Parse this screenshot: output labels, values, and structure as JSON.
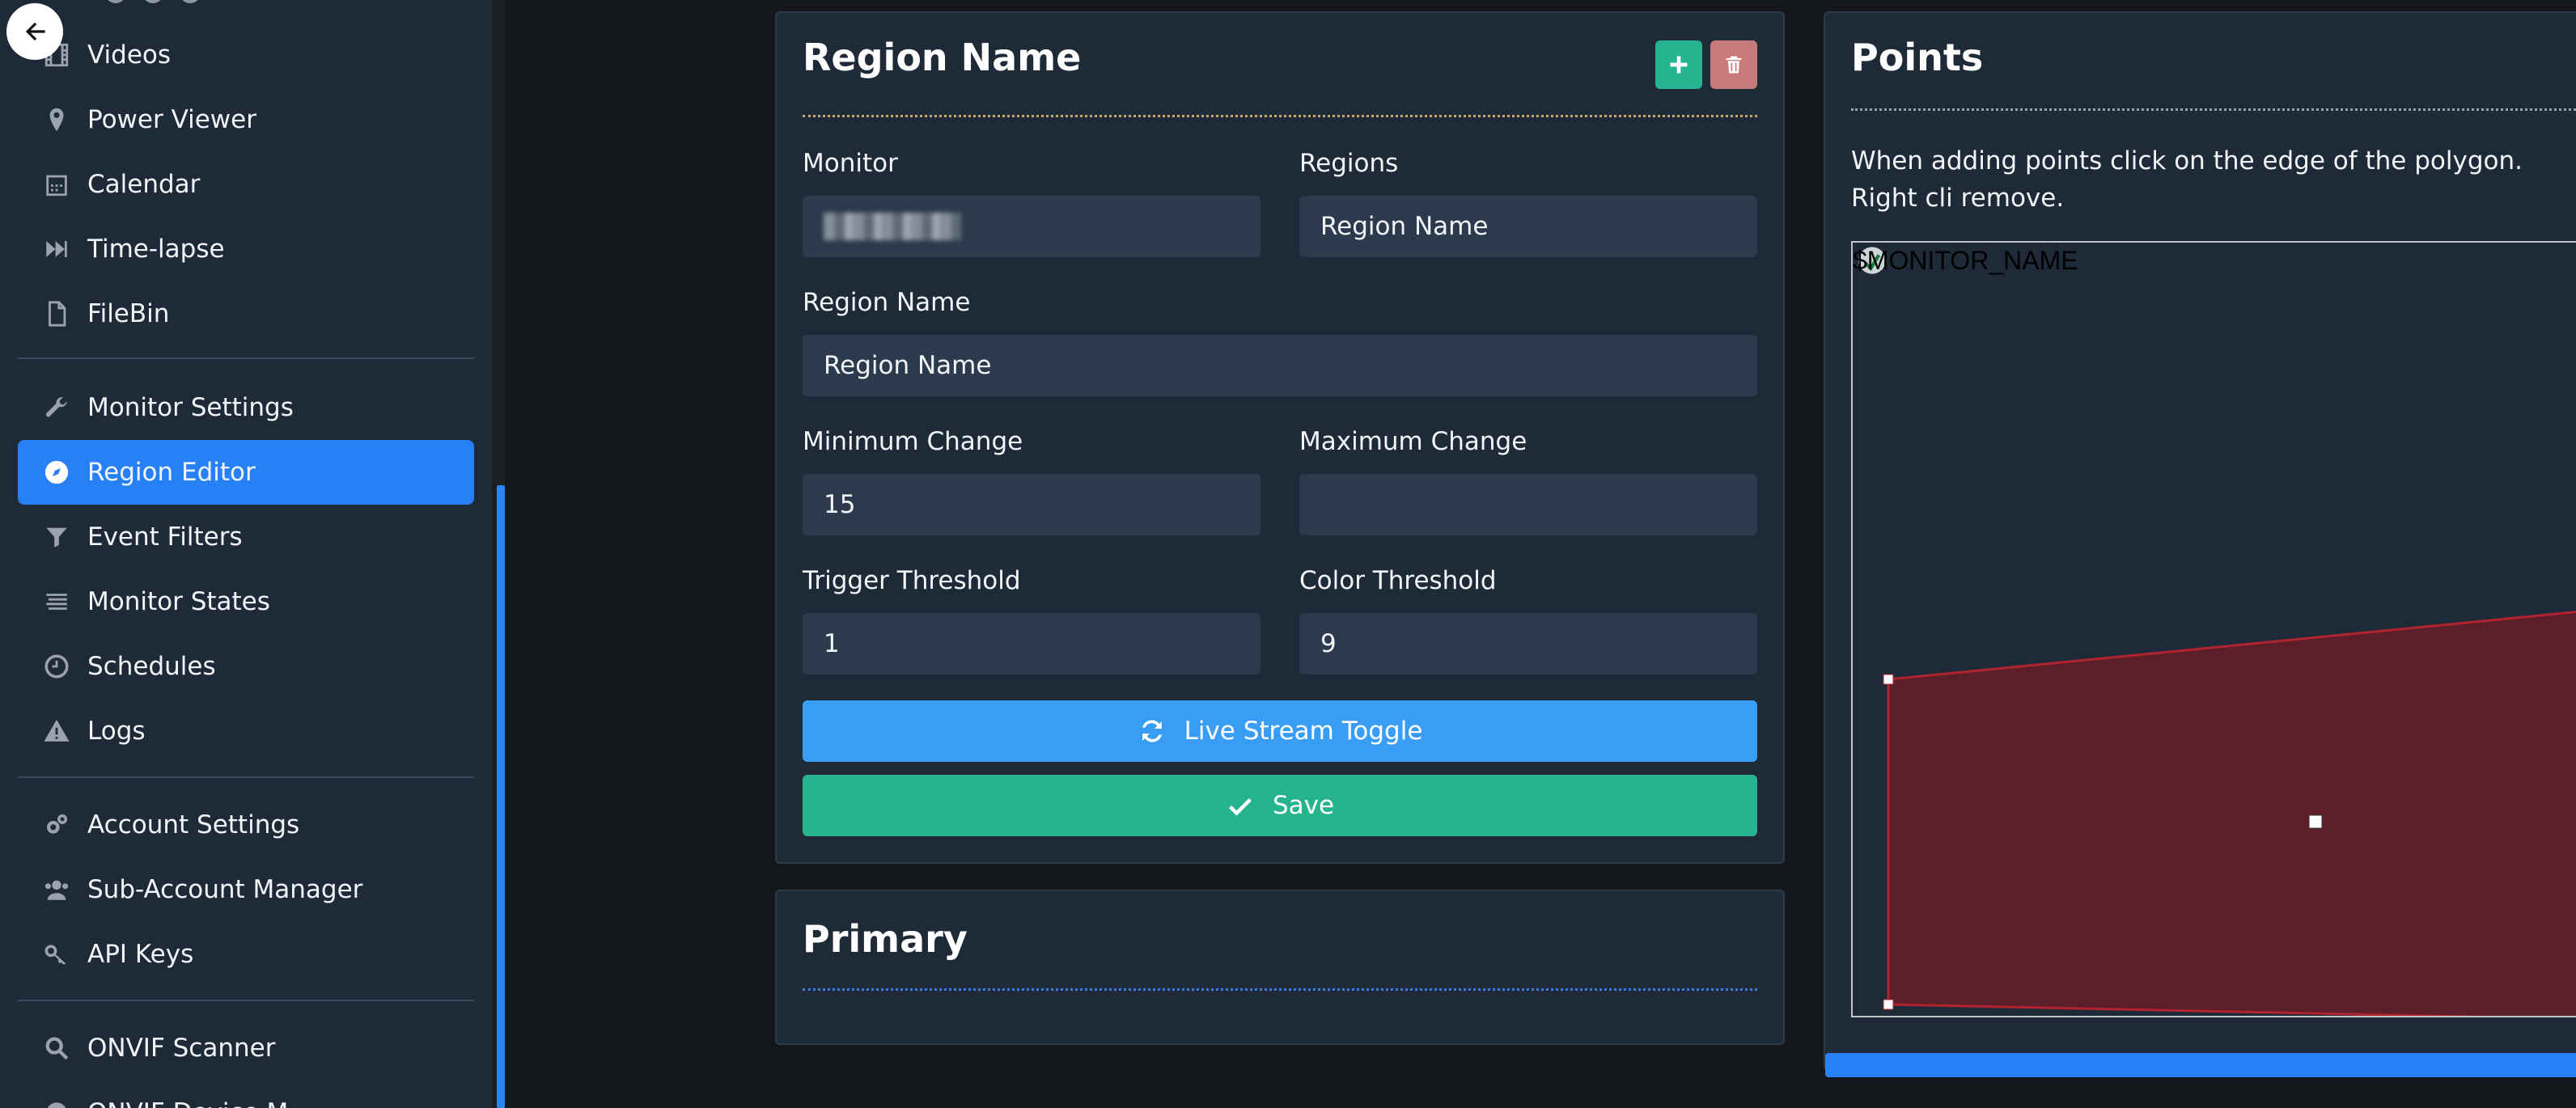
{
  "sidebar": {
    "items": [
      {
        "label": "Videos",
        "icon": "film-icon"
      },
      {
        "label": "Power Viewer",
        "icon": "map-pin-icon"
      },
      {
        "label": "Calendar",
        "icon": "calendar-icon"
      },
      {
        "label": "Time-lapse",
        "icon": "fast-forward-icon"
      },
      {
        "label": "FileBin",
        "icon": "file-icon"
      },
      {
        "label": "Monitor Settings",
        "icon": "wrench-icon"
      },
      {
        "label": "Region Editor",
        "icon": "compass-icon",
        "active": true
      },
      {
        "label": "Event Filters",
        "icon": "filter-icon"
      },
      {
        "label": "Monitor States",
        "icon": "list-icon"
      },
      {
        "label": "Schedules",
        "icon": "clock-icon"
      },
      {
        "label": "Logs",
        "icon": "warning-icon"
      },
      {
        "label": "Account Settings",
        "icon": "cogs-icon"
      },
      {
        "label": "Sub-Account Manager",
        "icon": "users-icon"
      },
      {
        "label": "API Keys",
        "icon": "key-icon"
      },
      {
        "label": "ONVIF Scanner",
        "icon": "search-icon"
      },
      {
        "label": "ONVIF Device M",
        "icon": "globe-icon"
      }
    ]
  },
  "region_card": {
    "title": "Region Name",
    "monitor_label": "Monitor",
    "regions_label": "Regions",
    "regions_value": "Region Name",
    "region_name_label": "Region Name",
    "region_name_value": "Region Name",
    "min_change_label": "Minimum Change",
    "min_change_value": "15",
    "max_change_label": "Maximum Change",
    "max_change_value": "",
    "trigger_threshold_label": "Trigger Threshold",
    "trigger_threshold_value": "1",
    "color_threshold_label": "Color Threshold",
    "color_threshold_value": "9",
    "live_stream_label": "Live Stream Toggle",
    "save_label": "Save"
  },
  "primary_card": {
    "title": "Primary"
  },
  "points_card": {
    "title": "Points",
    "help_text": "When adding points click on the edge of the polygon. Right cli remove.",
    "canvas_label": "$MONITOR_NAME"
  },
  "colors": {
    "accent": "#2780f5",
    "success": "#26b38f",
    "danger": "#c97a7a",
    "info": "#3a9df5",
    "polygon_fill": "#5c1f29",
    "polygon_stroke": "#b0232f"
  }
}
